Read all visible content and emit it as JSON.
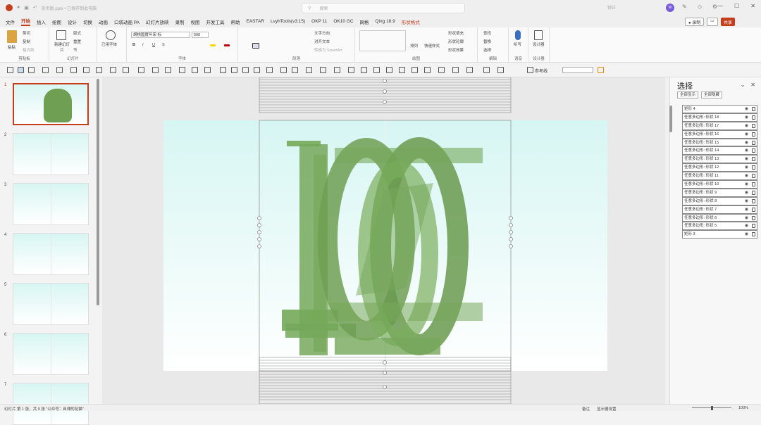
{
  "titlebar": {
    "doc_title": "拆页版.pptx • 已保存到此电脑",
    "search_placeholder": "搜索",
    "user": "钟正",
    "avatar": "W"
  },
  "tabs": [
    "文件",
    "开始",
    "插入",
    "绘图",
    "设计",
    "切换",
    "动画",
    "口袋动画 PA",
    "幻灯片放映",
    "录制",
    "视图",
    "开发工具",
    "帮助",
    "EASTAR",
    "LvyhTools(v3.15)",
    "OKP 11",
    "OK10 GC",
    "网格",
    "Qing 18.9",
    "形状格式"
  ],
  "active_tab": "开始",
  "right_buttons": {
    "record": "● 录制",
    "share": "共享"
  },
  "ribbon": {
    "clipboard": {
      "label": "剪贴板",
      "paste": "粘贴",
      "cut": "剪切",
      "copy": "复制",
      "format": "格式刷"
    },
    "slides": {
      "label": "幻灯片",
      "new": "新建幻灯片",
      "layout": "版式",
      "reset": "重置",
      "section": "节"
    },
    "font": {
      "label": "字体",
      "font_name": "胡桃国度年宋 标",
      "font_size": "500",
      "b": "B",
      "i": "I",
      "u": "U",
      "s": "S"
    },
    "paragraph": {
      "label": "段落",
      "text_dir": "文字方向",
      "align_text": "对齐文本",
      "smartart": "转换为 SmartArt"
    },
    "drawing": {
      "label": "绘图",
      "arrange": "排列",
      "quick_styles": "快速样式",
      "fill": "形状填充",
      "outline": "形状轮廓",
      "effect": "形状效果"
    },
    "editing": {
      "label": "编辑",
      "find": "查找",
      "replace": "替换",
      "select": "选择"
    },
    "voice": {
      "label": "语音",
      "dictate": "听写"
    },
    "designer": {
      "label": "设计器",
      "design": "设计器"
    },
    "used_font": "已用字体"
  },
  "toolbar2": {
    "guides": "参考线"
  },
  "slides": [
    {
      "num": "1"
    },
    {
      "num": "2"
    },
    {
      "num": "3"
    },
    {
      "num": "4"
    },
    {
      "num": "5"
    },
    {
      "num": "6"
    },
    {
      "num": "7"
    }
  ],
  "selection_pane": {
    "title": "选择",
    "show_all": "全部显示",
    "hide_all": "全部隐藏",
    "items": [
      "矩形 4",
      "任意多边形: 形状 18",
      "任意多边形: 形状 17",
      "任意多边形: 形状 16",
      "任意多边形: 形状 15",
      "任意多边形: 形状 14",
      "任意多边形: 形状 13",
      "任意多边形: 形状 12",
      "任意多边形: 形状 11",
      "任意多边形: 形状 10",
      "任意多边形: 形状 9",
      "任意多边形: 形状 8",
      "任意多边形: 形状 7",
      "任意多边形: 形状 6",
      "任意多边形: 形状 5",
      "矩形 3"
    ]
  },
  "statusbar": {
    "left": "幻灯片 第 1 张，共 9 张   \"公众号：自律的花猫\"",
    "notes": "备注",
    "display_settings": "显示器设置",
    "zoom": "100%"
  },
  "colors": {
    "accent": "#c43e1c",
    "shape_green": "#6e9f52",
    "slide_top": "#d6f6f3"
  }
}
